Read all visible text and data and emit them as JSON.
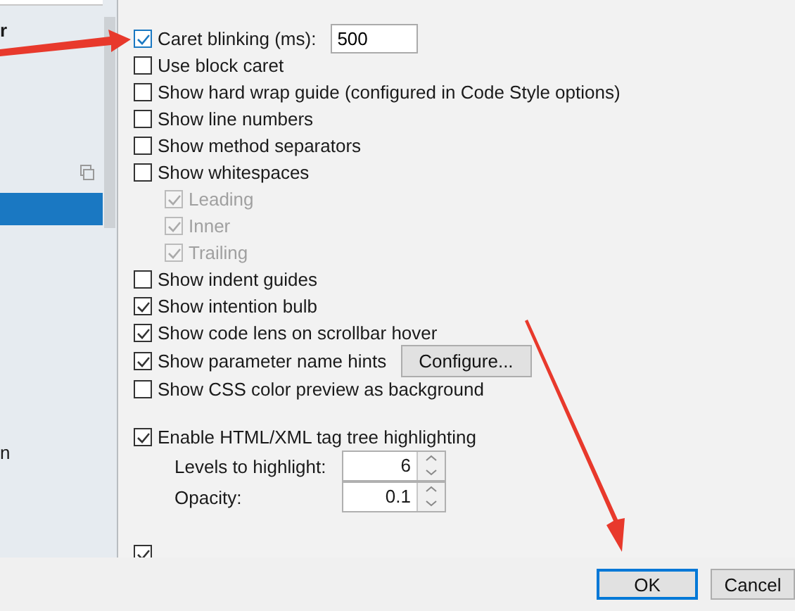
{
  "sidebar": {
    "fragments": [
      {
        "text": "r",
        "bold": true
      },
      {
        "text": "n",
        "bold": false
      }
    ],
    "selected_row": true
  },
  "editor_options": [
    {
      "kind": "input",
      "label": "Caret blinking (ms):",
      "checked": true,
      "focused": true,
      "value": "500"
    },
    {
      "kind": "checkbox",
      "label": "Use block caret",
      "checked": false
    },
    {
      "kind": "checkbox",
      "label": "Show hard wrap guide (configured in Code Style options)",
      "checked": false
    },
    {
      "kind": "checkbox",
      "label": "Show line numbers",
      "checked": false
    },
    {
      "kind": "checkbox",
      "label": "Show method separators",
      "checked": false
    },
    {
      "kind": "checkbox",
      "label": "Show whitespaces",
      "checked": false,
      "children": [
        {
          "label": "Leading",
          "checked": true,
          "disabled": true
        },
        {
          "label": "Inner",
          "checked": true,
          "disabled": true
        },
        {
          "label": "Trailing",
          "checked": true,
          "disabled": true
        }
      ]
    },
    {
      "kind": "checkbox",
      "label": "Show indent guides",
      "checked": false
    },
    {
      "kind": "checkbox",
      "label": "Show intention bulb",
      "checked": true
    },
    {
      "kind": "checkbox",
      "label": "Show code lens on scrollbar hover",
      "checked": true
    },
    {
      "kind": "button",
      "label": "Show parameter name hints",
      "checked": true,
      "button": "Configure..."
    },
    {
      "kind": "checkbox",
      "label": "Show CSS color preview as background",
      "checked": false
    }
  ],
  "tag_tree": {
    "label": "Enable HTML/XML tag tree highlighting",
    "checked": true,
    "spinners": [
      {
        "label": "Levels to highlight:",
        "value": "6"
      },
      {
        "label": "Opacity:",
        "value": "0.1"
      }
    ]
  },
  "cut_option": {
    "checked": true
  },
  "buttons": [
    {
      "label": "OK",
      "default": true
    },
    {
      "label": "Cancel",
      "default": false
    }
  ]
}
